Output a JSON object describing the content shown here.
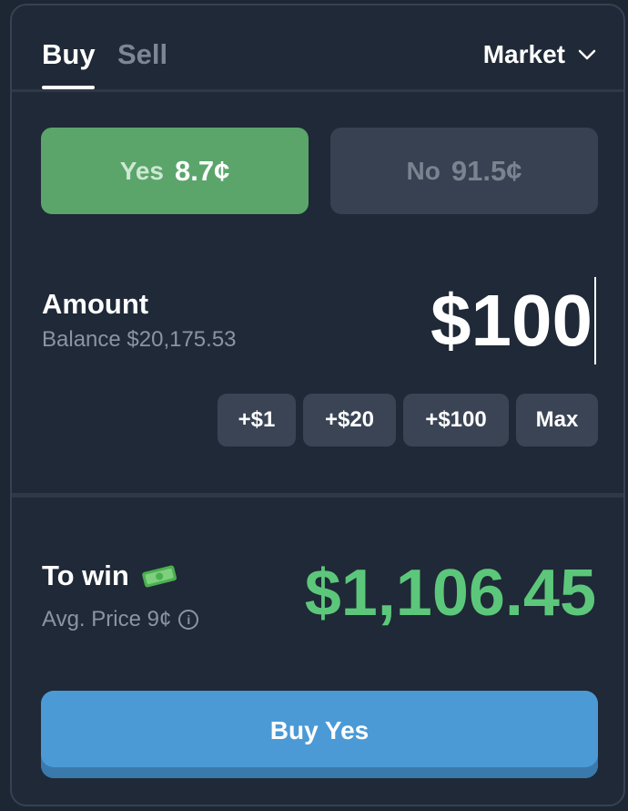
{
  "tabs": {
    "buy": "Buy",
    "sell": "Sell",
    "active": "Buy"
  },
  "order_type": {
    "label": "Market",
    "icon": "chevron-down-icon"
  },
  "outcomes": {
    "yes": {
      "label": "Yes",
      "price": "8.7¢",
      "selected": true,
      "color": "#5ba56b"
    },
    "no": {
      "label": "No",
      "price": "91.5¢",
      "selected": false,
      "color": "#374151"
    }
  },
  "amount": {
    "label": "Amount",
    "balance": "Balance $20,175.53",
    "value": "$100"
  },
  "quick_add": [
    "+$1",
    "+$20",
    "+$100",
    "Max"
  ],
  "to_win": {
    "label": "To win",
    "icon": "money-icon",
    "avg_price": "Avg. Price 9¢",
    "info_icon": "info-icon",
    "value": "$1,106.45",
    "color": "#5cc77a"
  },
  "action": {
    "label": "Buy Yes",
    "color": "#4b9ad6"
  }
}
